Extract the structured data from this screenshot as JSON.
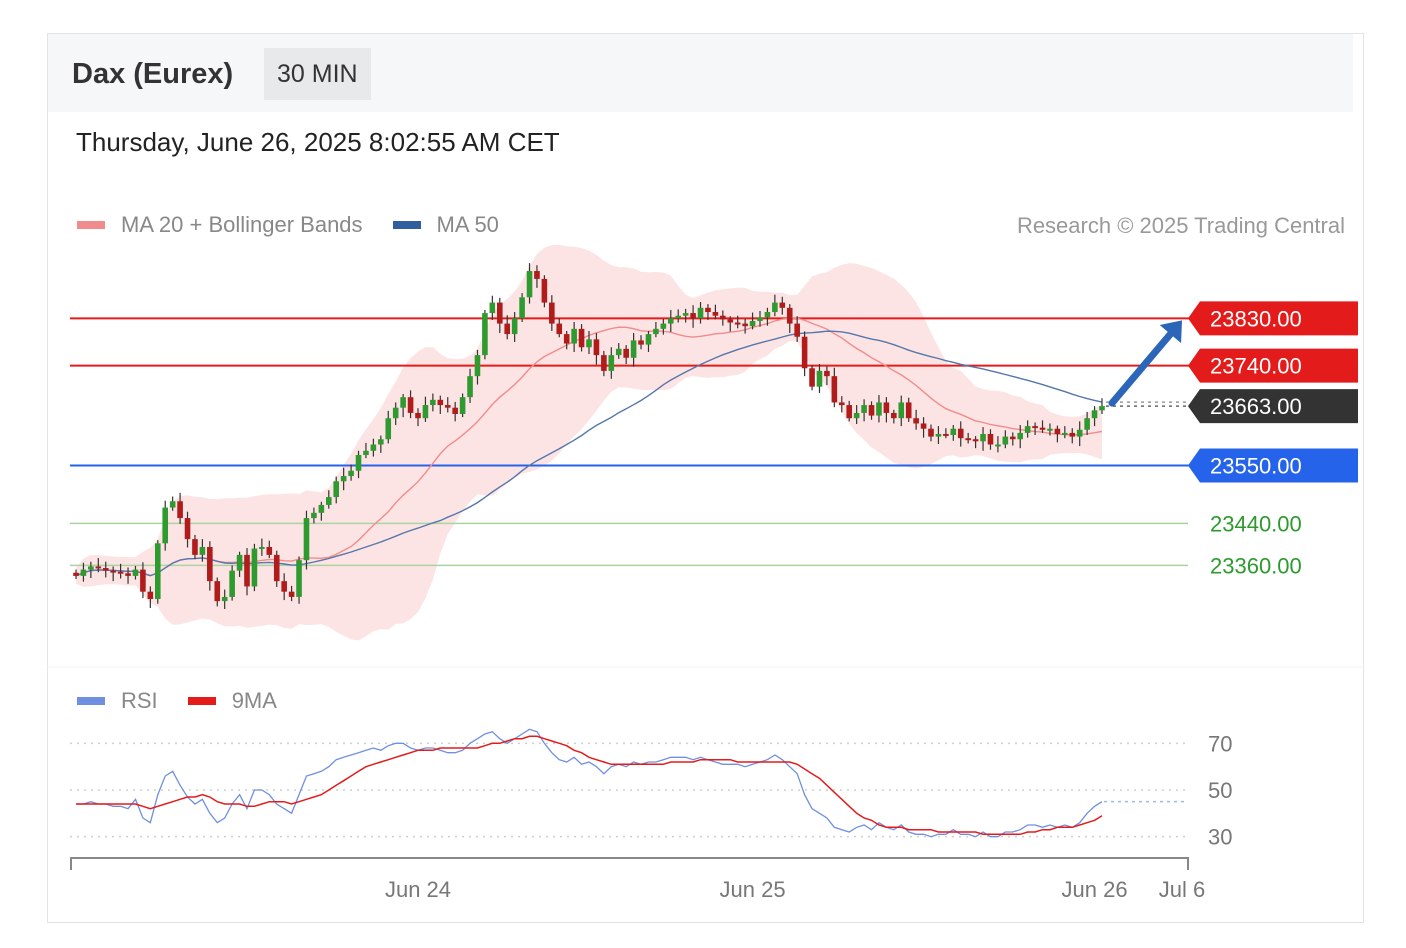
{
  "header": {
    "title": "Dax (Eurex)",
    "interval": "30 MIN"
  },
  "timestamp": "Thursday, June 26, 2025 8:02:55 AM CET",
  "legend_main": [
    {
      "label": "MA 20 + Bollinger Bands",
      "color": "#f28b8b"
    },
    {
      "label": "MA 50",
      "color": "#2f5f9e"
    }
  ],
  "credit": "Research © 2025 Trading Central",
  "legend_rsi": [
    {
      "label": "RSI",
      "color": "#6f8fe0"
    },
    {
      "label": "9MA",
      "color": "#e31b1b"
    }
  ],
  "chart_data": {
    "type": "candlestick",
    "price_levels": [
      {
        "label": "23830.00",
        "value": 23830,
        "kind": "resistance",
        "color": "#e31b1b"
      },
      {
        "label": "23740.00",
        "value": 23740,
        "kind": "resistance",
        "color": "#e31b1b"
      },
      {
        "label": "23663.00",
        "value": 23663,
        "kind": "last",
        "color": "#333333"
      },
      {
        "label": "23550.00",
        "value": 23550,
        "kind": "pivot",
        "color": "#2563eb"
      },
      {
        "label": "23440.00",
        "value": 23440,
        "kind": "support",
        "color": "#2e9a2e"
      },
      {
        "label": "23360.00",
        "value": 23360,
        "kind": "support",
        "color": "#2e9a2e"
      }
    ],
    "y_range": [
      23180,
      23960
    ],
    "x_labels": [
      "Jun 24",
      "Jun 25",
      "Jun 26",
      "Jul 6"
    ],
    "close": [
      23340,
      23352,
      23358,
      23355,
      23350,
      23348,
      23345,
      23340,
      23352,
      23310,
      23296,
      23402,
      23470,
      23482,
      23450,
      23410,
      23380,
      23395,
      23330,
      23292,
      23300,
      23350,
      23380,
      23320,
      23392,
      23395,
      23380,
      23330,
      23310,
      23300,
      23370,
      23450,
      23460,
      23475,
      23490,
      23520,
      23530,
      23540,
      23570,
      23578,
      23590,
      23600,
      23640,
      23660,
      23680,
      23650,
      23640,
      23665,
      23675,
      23665,
      23660,
      23648,
      23680,
      23720,
      23760,
      23840,
      23860,
      23820,
      23800,
      23830,
      23870,
      23920,
      23905,
      23860,
      23820,
      23800,
      23782,
      23810,
      23775,
      23790,
      23760,
      23730,
      23760,
      23772,
      23755,
      23788,
      23780,
      23800,
      23810,
      23820,
      23830,
      23835,
      23840,
      23830,
      23850,
      23842,
      23835,
      23828,
      23822,
      23820,
      23815,
      23825,
      23832,
      23842,
      23860,
      23850,
      23820,
      23795,
      23735,
      23700,
      23730,
      23720,
      23670,
      23665,
      23640,
      23650,
      23665,
      23645,
      23670,
      23650,
      23640,
      23670,
      23640,
      23630,
      23620,
      23605,
      23610,
      23608,
      23620,
      23602,
      23600,
      23596,
      23610,
      23590,
      23590,
      23605,
      23600,
      23612,
      23625,
      23622,
      23618,
      23620,
      23610,
      23612,
      23605,
      23618,
      23640,
      23655,
      23663
    ],
    "rsi": [
      44,
      44,
      45,
      44,
      44,
      43,
      43,
      42,
      46,
      38,
      36,
      48,
      56,
      58,
      52,
      47,
      44,
      46,
      40,
      36,
      38,
      44,
      48,
      42,
      50,
      50,
      48,
      44,
      42,
      40,
      48,
      56,
      57,
      58,
      60,
      63,
      64,
      65,
      66,
      67,
      68,
      67,
      69,
      70,
      70,
      68,
      67,
      68,
      68,
      67,
      66,
      66,
      67,
      70,
      72,
      74,
      75,
      72,
      70,
      72,
      74,
      76,
      75,
      70,
      66,
      63,
      62,
      64,
      61,
      62,
      60,
      57,
      60,
      61,
      60,
      62,
      61,
      62,
      62,
      63,
      64,
      64,
      64,
      63,
      64,
      63,
      62,
      61,
      61,
      61,
      60,
      61,
      62,
      63,
      65,
      63,
      60,
      57,
      48,
      42,
      40,
      38,
      34,
      33,
      32,
      34,
      35,
      33,
      36,
      34,
      33,
      35,
      32,
      31,
      31,
      30,
      31,
      31,
      33,
      31,
      31,
      30,
      32,
      30,
      30,
      32,
      32,
      33,
      35,
      35,
      34,
      35,
      34,
      35,
      34,
      36,
      40,
      43,
      45
    ],
    "rsi_ma9": [
      44,
      44,
      44,
      44,
      44,
      44,
      44,
      44,
      44,
      43,
      42,
      43,
      44,
      45,
      46,
      47,
      47,
      48,
      47,
      45,
      44,
      44,
      44,
      43,
      43,
      44,
      45,
      45,
      45,
      44,
      45,
      46,
      47,
      48,
      50,
      52,
      54,
      56,
      58,
      60,
      61,
      62,
      63,
      64,
      65,
      66,
      67,
      67,
      67,
      68,
      68,
      68,
      68,
      68,
      68,
      69,
      70,
      70,
      71,
      72,
      72,
      73,
      73,
      72,
      71,
      70,
      69,
      67,
      66,
      64,
      63,
      62,
      61,
      61,
      61,
      61,
      61,
      61,
      61,
      61,
      62,
      62,
      62,
      62,
      63,
      63,
      63,
      63,
      63,
      62,
      62,
      62,
      62,
      62,
      62,
      62,
      62,
      61,
      59,
      57,
      55,
      52,
      49,
      46,
      43,
      40,
      38,
      37,
      35,
      34,
      34,
      34,
      33,
      33,
      33,
      33,
      32,
      32,
      32,
      32,
      32,
      32,
      31,
      31,
      31,
      31,
      31,
      31,
      32,
      32,
      33,
      33,
      34,
      34,
      34,
      35,
      36,
      37,
      39
    ],
    "rsi_levels": [
      70,
      50,
      30
    ],
    "rsi_range": [
      20,
      80
    ],
    "arrow": {
      "direction": "up",
      "from": 23663,
      "to": 23830
    }
  }
}
